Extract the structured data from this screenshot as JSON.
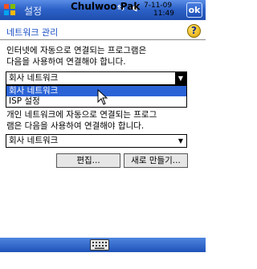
{
  "titlebar": {
    "app_title": "설정",
    "owner": "Chulwoo Pak",
    "date": "7-11-09",
    "time": "11:49",
    "ok_label": "ok",
    "accent": "#2d62c8"
  },
  "page": {
    "title": "네트워크 관리",
    "help_label": "?"
  },
  "internet_section": {
    "desc_line1": "인터넷에 자동으로 연결되는 프로그램은",
    "desc_line2": "다음을 사용하여 연결해야 합니다.",
    "selected_value": "회사 네트워크",
    "options": [
      "회사 네트워크",
      "ISP 설정"
    ],
    "highlighted_option": "회사 네트워크"
  },
  "private_section": {
    "desc_line1": "개인 네트워크에 자동으로 연결되는 프로그",
    "desc_line2": "램은 다음을 사용하여 연결해야 합니다.",
    "selected_value": "회사 네트워크"
  },
  "buttons": {
    "edit_label": "편집...",
    "new_label": "새로 만들기..."
  },
  "colors": {
    "selection": "#2b63d6",
    "title_text": "#1a4fc4"
  }
}
